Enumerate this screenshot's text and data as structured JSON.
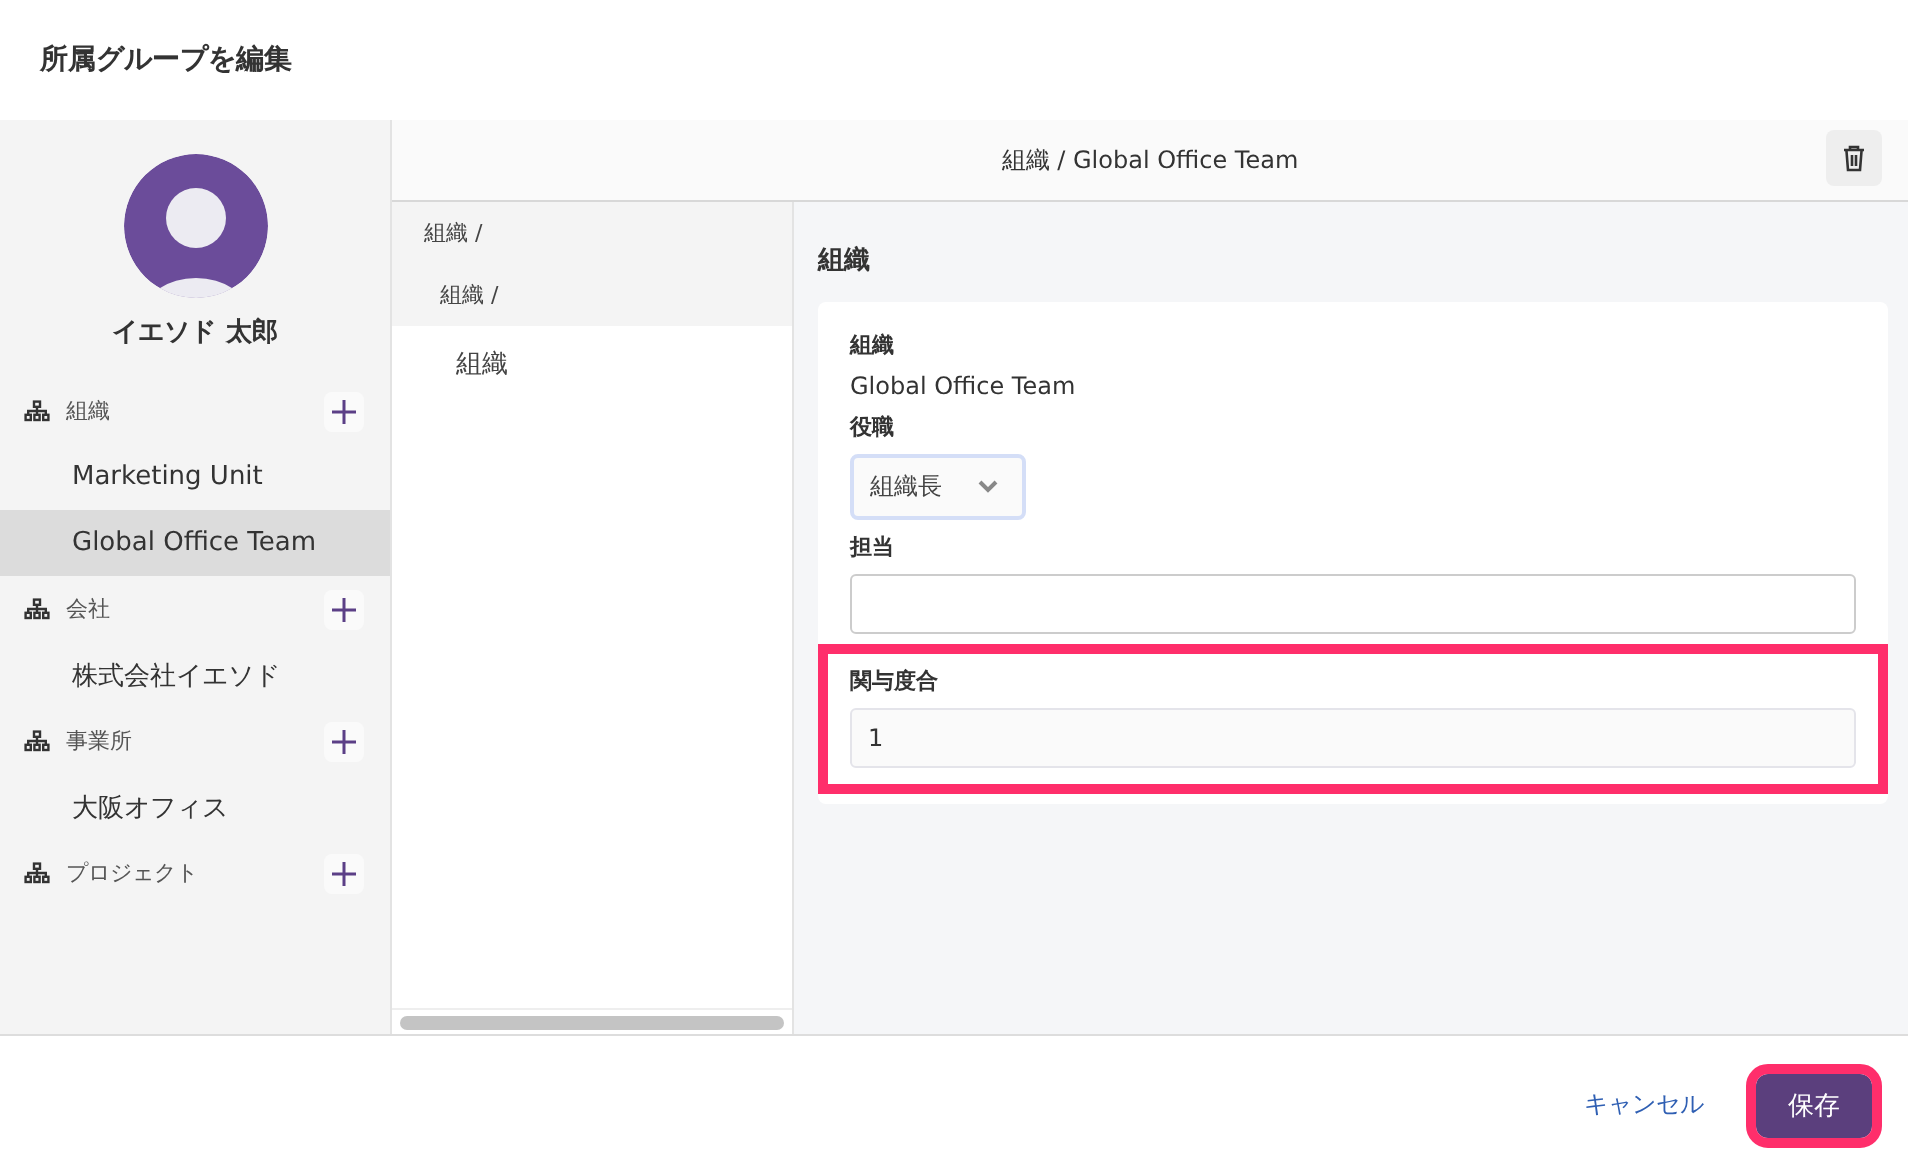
{
  "window": {
    "title": "所属グループを編集"
  },
  "profile": {
    "name": "イエソド 太郎"
  },
  "sidebar": {
    "sections": [
      {
        "label": "組織",
        "items": [
          {
            "label": "Marketing Unit",
            "selected": false
          },
          {
            "label": "Global Office Team",
            "selected": true
          }
        ]
      },
      {
        "label": "会社",
        "items": [
          {
            "label": "株式会社イエソド",
            "selected": false
          }
        ]
      },
      {
        "label": "事業所",
        "items": [
          {
            "label": "大阪オフィス",
            "selected": false
          }
        ]
      },
      {
        "label": "プロジェクト"
      }
    ]
  },
  "main": {
    "title": "組織 / Global Office Team"
  },
  "tree": [
    {
      "label": "組織 /",
      "children": [
        {
          "label": "組織 /",
          "children": [
            {
              "label": "組織"
            }
          ]
        }
      ]
    }
  ],
  "details": {
    "heading": "組織",
    "fields": [
      {
        "kind": "text",
        "label": "組織",
        "value": "Global Office Team",
        "highlighted": false
      },
      {
        "kind": "select",
        "label": "役職",
        "value": "組織長",
        "highlighted": false
      },
      {
        "kind": "input",
        "label": "担当",
        "highlighted": false
      },
      {
        "kind": "input",
        "label": "関与度合",
        "value": "1",
        "highlighted": true
      }
    ]
  },
  "footer": {
    "cancel": "キャンセル",
    "save": {
      "label": "保存",
      "highlighted": true
    }
  }
}
